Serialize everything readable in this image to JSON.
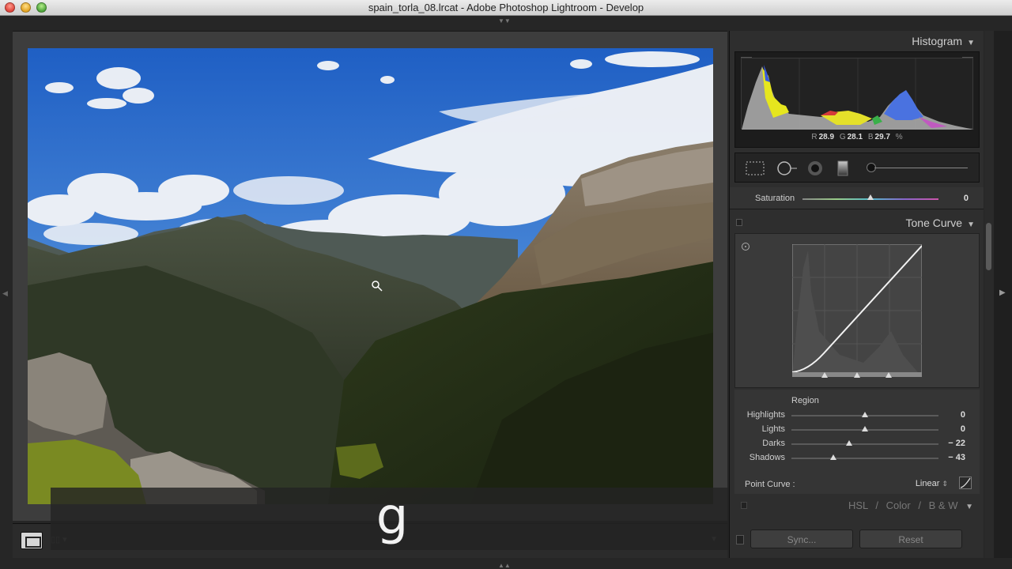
{
  "window": {
    "title": "spain_torla_08.lrcat - Adobe Photoshop Lightroom - Develop"
  },
  "histogram": {
    "header": "Histogram",
    "r_label": "R",
    "r_value": "28.9",
    "g_label": "G",
    "g_value": "28.1",
    "b_label": "B",
    "b_value": "29.7",
    "unit": "%"
  },
  "saturation": {
    "label": "Saturation",
    "value": "0",
    "level": 0.5
  },
  "tone_curve": {
    "header": "Tone Curve",
    "region_title": "Region",
    "sliders": [
      {
        "label": "Highlights",
        "value": "0",
        "level": 0.5
      },
      {
        "label": "Lights",
        "value": "0",
        "level": 0.5
      },
      {
        "label": "Darks",
        "value": "− 22",
        "level": 0.39
      },
      {
        "label": "Shadows",
        "value": "− 43",
        "level": 0.285
      }
    ],
    "point_curve_label": "Point Curve :",
    "point_curve_value": "Linear"
  },
  "hsl": {
    "hsl": "HSL",
    "color": "Color",
    "bw": "B & W",
    "sep": "/"
  },
  "buttons": {
    "sync": "Sync...",
    "reset": "Reset"
  },
  "key_overlay": {
    "key": "g"
  },
  "icons": {
    "crop": "crop-overlay-icon",
    "spot": "spot-removal-icon",
    "redeye": "red-eye-icon",
    "gradient": "graduated-filter-icon",
    "brush": "adjustment-brush-icon"
  }
}
